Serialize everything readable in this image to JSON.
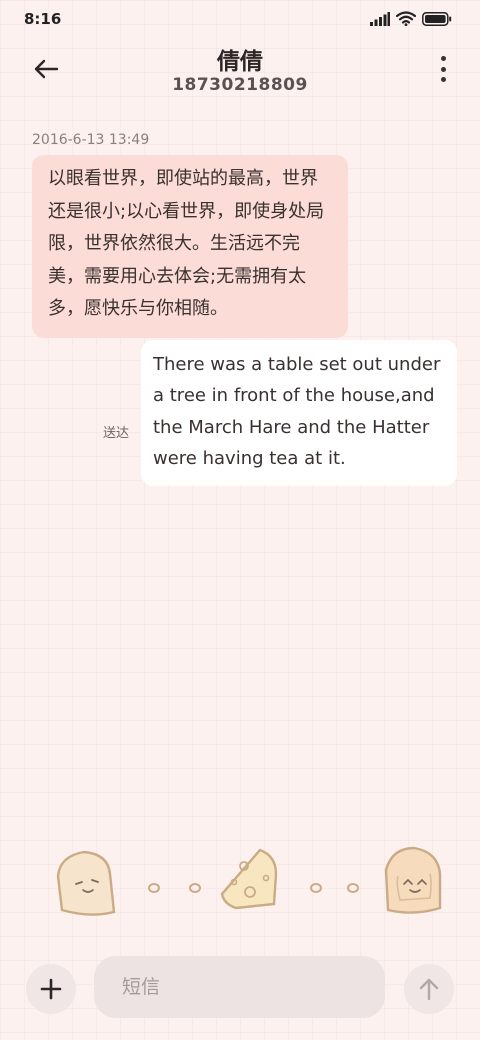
{
  "status_bar": {
    "time": "8:16",
    "icons": [
      "signal-icon",
      "wifi-icon",
      "battery-icon"
    ]
  },
  "header": {
    "contact_name": "倩倩",
    "phone_number": "18730218809",
    "icons": [
      "back-arrow-icon",
      "more-vertical-icon"
    ]
  },
  "conversation": {
    "timestamp": "2016-6-13 13:49",
    "incoming_message": "以眼看世界，即使站的最高，世界还是很小;以心看世界，即使身处局限，世界依然很大。生活远不完美，需要用心去体会;无需拥有太多，愿快乐与你相随。",
    "outgoing_message": "There was a table set out under a tree in front of the house,and the March Hare and the Hatter were having tea at it.",
    "outgoing_status": "送达"
  },
  "composer": {
    "placeholder": "短信",
    "value": "",
    "icons": [
      "plus-icon",
      "send-arrow-icon"
    ]
  },
  "colors": {
    "background": "#fcf1ef",
    "incoming_bubble": "#fbdcd6",
    "outgoing_bubble": "#ffffff",
    "input_background": "#ece3e2",
    "button_background": "#f0e6e5"
  }
}
